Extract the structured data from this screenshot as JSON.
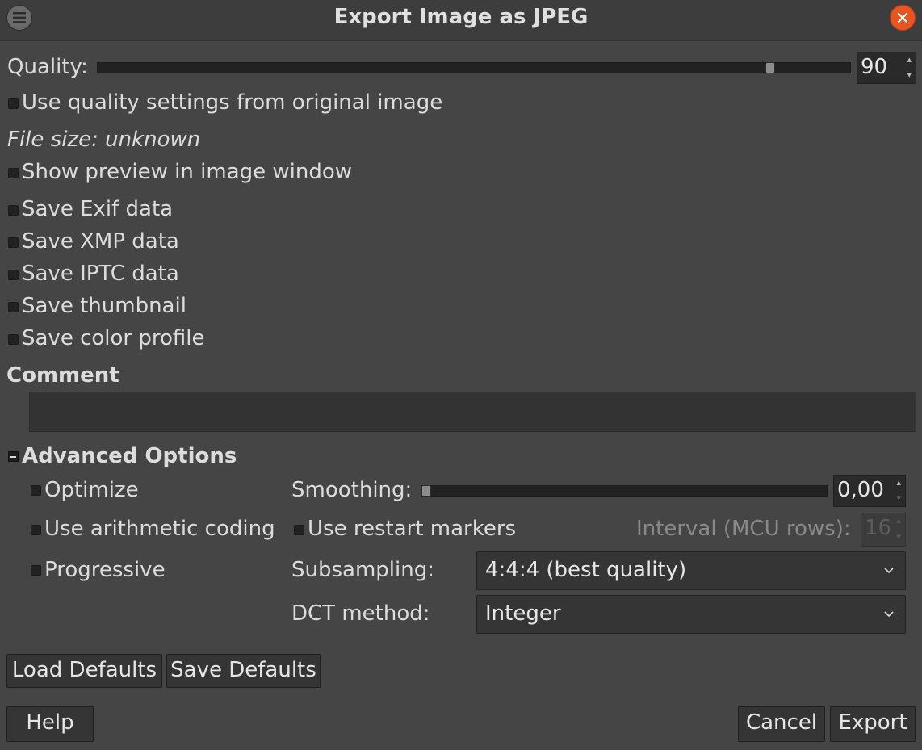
{
  "window": {
    "title": "Export Image as JPEG",
    "menu_icon": "hamburger-menu-icon",
    "close_icon": "close-icon"
  },
  "quality": {
    "label": "Quality:",
    "value": "90",
    "value_fraction": 0.9
  },
  "options": {
    "use_original_quality": "Use quality settings from original image",
    "file_size": "File size: unknown",
    "show_preview": "Show preview in image window",
    "save_exif": "Save Exif data",
    "save_xmp": "Save XMP data",
    "save_iptc": "Save IPTC data",
    "save_thumbnail": "Save thumbnail",
    "save_color_profile": "Save color profile"
  },
  "comment": {
    "label": "Comment",
    "value": ""
  },
  "advanced": {
    "title": "Advanced Options",
    "optimize": "Optimize",
    "arithmetic": "Use arithmetic coding",
    "progressive": "Progressive",
    "smoothing_label": "Smoothing:",
    "smoothing_value": "0,00",
    "smoothing_fraction": 0.0,
    "restart_markers": "Use restart markers",
    "interval_label": "Interval (MCU rows):",
    "interval_value": "16",
    "subsampling_label": "Subsampling:",
    "subsampling_value": "4:4:4 (best quality)",
    "dct_label": "DCT method:",
    "dct_value": "Integer"
  },
  "buttons": {
    "load_defaults": "Load Defaults",
    "save_defaults": "Save Defaults",
    "help": "Help",
    "cancel": "Cancel",
    "export": "Export"
  },
  "colors": {
    "background": "#454545",
    "close_accent": "#e95420"
  }
}
